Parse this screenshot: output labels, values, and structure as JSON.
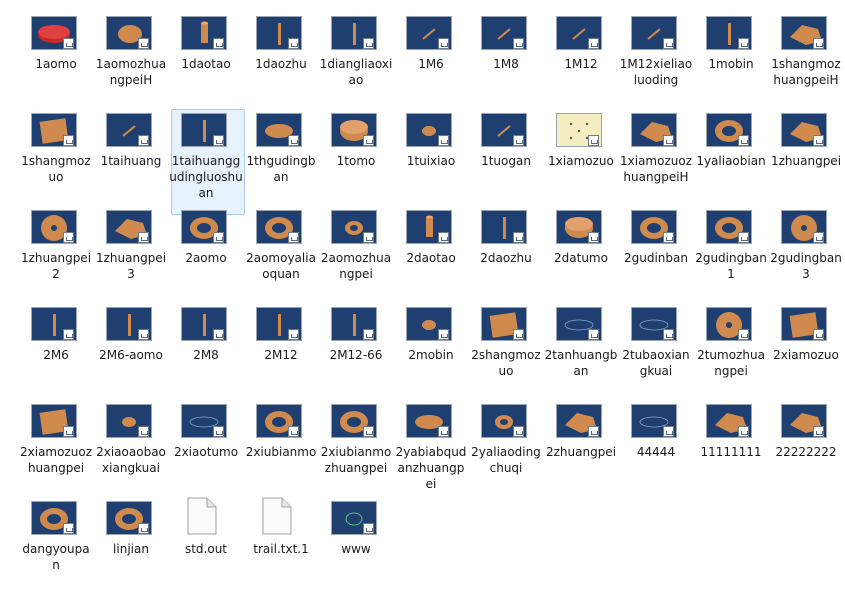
{
  "files": [
    {
      "name": "1aomo",
      "thumb": "navy",
      "shape": "red-disc"
    },
    {
      "name": "1aomozhuangpeiH",
      "thumb": "navy",
      "shape": "plate"
    },
    {
      "name": "1daotao",
      "thumb": "navy",
      "shape": "cylinder"
    },
    {
      "name": "1daozhu",
      "thumb": "navy",
      "shape": "pin"
    },
    {
      "name": "1diangliaoxiao",
      "thumb": "navy",
      "shape": "pin"
    },
    {
      "name": "1M6",
      "thumb": "navy",
      "shape": "line"
    },
    {
      "name": "1M8",
      "thumb": "navy",
      "shape": "line"
    },
    {
      "name": "1M12",
      "thumb": "navy",
      "shape": "line"
    },
    {
      "name": "1M12xieliaoluoding",
      "thumb": "navy",
      "shape": "line"
    },
    {
      "name": "1mobin",
      "thumb": "navy",
      "shape": "pin"
    },
    {
      "name": "1shangmozhuangpeiH",
      "thumb": "navy",
      "shape": "assembly"
    },
    {
      "name": "1shangmozuo",
      "thumb": "navy",
      "shape": "square-plate"
    },
    {
      "name": "1taihuang",
      "thumb": "navy",
      "shape": "line"
    },
    {
      "name": "1taihuanggudingluoshuan",
      "thumb": "navy",
      "shape": "pin",
      "selected": true
    },
    {
      "name": "1thgudingban",
      "thumb": "navy",
      "shape": "ellipse"
    },
    {
      "name": "1tomo",
      "thumb": "navy",
      "shape": "disc"
    },
    {
      "name": "1tuixiao",
      "thumb": "navy",
      "shape": "small-disc"
    },
    {
      "name": "1tuogan",
      "thumb": "navy",
      "shape": "line"
    },
    {
      "name": "1xiamozuo",
      "thumb": "cream",
      "shape": "dots"
    },
    {
      "name": "1xiamozuozhuangpeiH",
      "thumb": "navy",
      "shape": "assembly"
    },
    {
      "name": "1yaliaobian",
      "thumb": "navy",
      "shape": "ring"
    },
    {
      "name": "1zhuangpei",
      "thumb": "navy",
      "shape": "assembly"
    },
    {
      "name": "1zhuangpei2",
      "thumb": "navy",
      "shape": "round-plate"
    },
    {
      "name": "1zhuangpei3",
      "thumb": "navy",
      "shape": "assembly"
    },
    {
      "name": "2aomo",
      "thumb": "navy",
      "shape": "ring"
    },
    {
      "name": "2aomoyaliaoquan",
      "thumb": "navy",
      "shape": "ring"
    },
    {
      "name": "2aomozhuangpei",
      "thumb": "navy",
      "shape": "small-ring"
    },
    {
      "name": "2daotao",
      "thumb": "navy",
      "shape": "cylinder"
    },
    {
      "name": "2daozhu",
      "thumb": "navy",
      "shape": "pin"
    },
    {
      "name": "2datumo",
      "thumb": "navy",
      "shape": "disc"
    },
    {
      "name": "2gudinban",
      "thumb": "navy",
      "shape": "ring"
    },
    {
      "name": "2gudingban1",
      "thumb": "navy",
      "shape": "ring"
    },
    {
      "name": "2gudingban3",
      "thumb": "navy",
      "shape": "round-plate"
    },
    {
      "name": "2M6",
      "thumb": "navy",
      "shape": "pin"
    },
    {
      "name": "2M6-aomo",
      "thumb": "navy",
      "shape": "pin"
    },
    {
      "name": "2M8",
      "thumb": "navy",
      "shape": "pin"
    },
    {
      "name": "2M12",
      "thumb": "navy",
      "shape": "pin"
    },
    {
      "name": "2M12-66",
      "thumb": "navy",
      "shape": "pin"
    },
    {
      "name": "2mobin",
      "thumb": "navy",
      "shape": "small-disc"
    },
    {
      "name": "2shangmozuo",
      "thumb": "navy",
      "shape": "square-plate"
    },
    {
      "name": "2tanhuangban",
      "thumb": "navy",
      "shape": "outline"
    },
    {
      "name": "2tubaoxiangkuai",
      "thumb": "navy",
      "shape": "outline"
    },
    {
      "name": "2tumozhuangpei",
      "thumb": "navy",
      "shape": "round-plate"
    },
    {
      "name": "2xiamozuo",
      "thumb": "navy",
      "shape": "square-plate"
    },
    {
      "name": "2xiamozuozhuangpei",
      "thumb": "navy",
      "shape": "square-plate"
    },
    {
      "name": "2xiaoaobaoxiangkuai",
      "thumb": "navy",
      "shape": "small-disc"
    },
    {
      "name": "2xiaotumo",
      "thumb": "navy",
      "shape": "outline"
    },
    {
      "name": "2xiubianmo",
      "thumb": "navy",
      "shape": "ring"
    },
    {
      "name": "2xiubianmozhuangpei",
      "thumb": "navy",
      "shape": "ring"
    },
    {
      "name": "2yabiabqudanzhuangpei",
      "thumb": "navy",
      "shape": "ellipse"
    },
    {
      "name": "2yaliaodingchuqi",
      "thumb": "navy",
      "shape": "small-ring"
    },
    {
      "name": "2zhuangpei",
      "thumb": "navy",
      "shape": "assembly"
    },
    {
      "name": "44444",
      "thumb": "navy",
      "shape": "outline"
    },
    {
      "name": "11111111",
      "thumb": "navy",
      "shape": "assembly"
    },
    {
      "name": "22222222",
      "thumb": "navy",
      "shape": "assembly"
    },
    {
      "name": "dangyoupan",
      "thumb": "navy",
      "shape": "ring"
    },
    {
      "name": "linjian",
      "thumb": "navy",
      "shape": "ring"
    },
    {
      "name": "std.out",
      "thumb": "doc",
      "shape": "doc"
    },
    {
      "name": "trail.txt.1",
      "thumb": "doc",
      "shape": "doc"
    },
    {
      "name": "www",
      "thumb": "navy",
      "shape": "outline-ring"
    }
  ],
  "colors": {
    "navy": "#1f3f70",
    "copper": "#d08a4e",
    "red": "#c8282a",
    "cream": "#f5eec3"
  }
}
